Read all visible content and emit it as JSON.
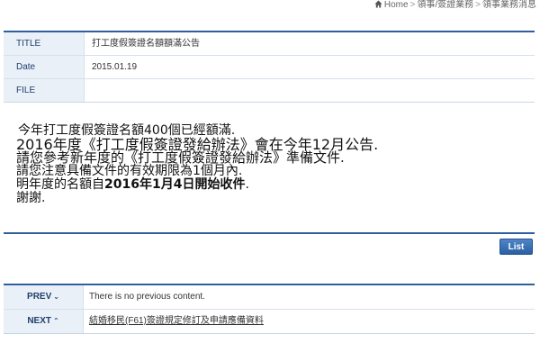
{
  "breadcrumb": {
    "home": "Home",
    "separator": ">",
    "level1": "領事/簽證業務",
    "level2": "領事業務消息"
  },
  "info": {
    "title_label": "TITLE",
    "title_value": "打工度假簽證名額額滿公告",
    "date_label": "Date",
    "date_value": "2015.01.19",
    "file_label": "FILE",
    "file_value": ""
  },
  "content": {
    "line1": "今年打工度假簽證名額400個已經額滿.",
    "line2": "2016年度《打工度假簽證發給辦法》會在今年12月公告.",
    "line3": "請您參考新年度的《打工度假簽證發給辦法》準備文件.",
    "line4": "請您注意具備文件的有效期限為1個月內.",
    "line5_pre": "明年度的名額自",
    "line5_bold": "2016年1月4日開始收件",
    "line5_post": ".",
    "line6": "謝謝."
  },
  "actions": {
    "list_label": "List"
  },
  "nav": {
    "prev_label": "PREV",
    "prev_chevron": "⌄",
    "prev_value": "There is no previous content.",
    "next_label": "NEXT",
    "next_chevron": "⌃",
    "next_value": "結婚移民(F61)簽證規定修訂及申請應備資料"
  }
}
